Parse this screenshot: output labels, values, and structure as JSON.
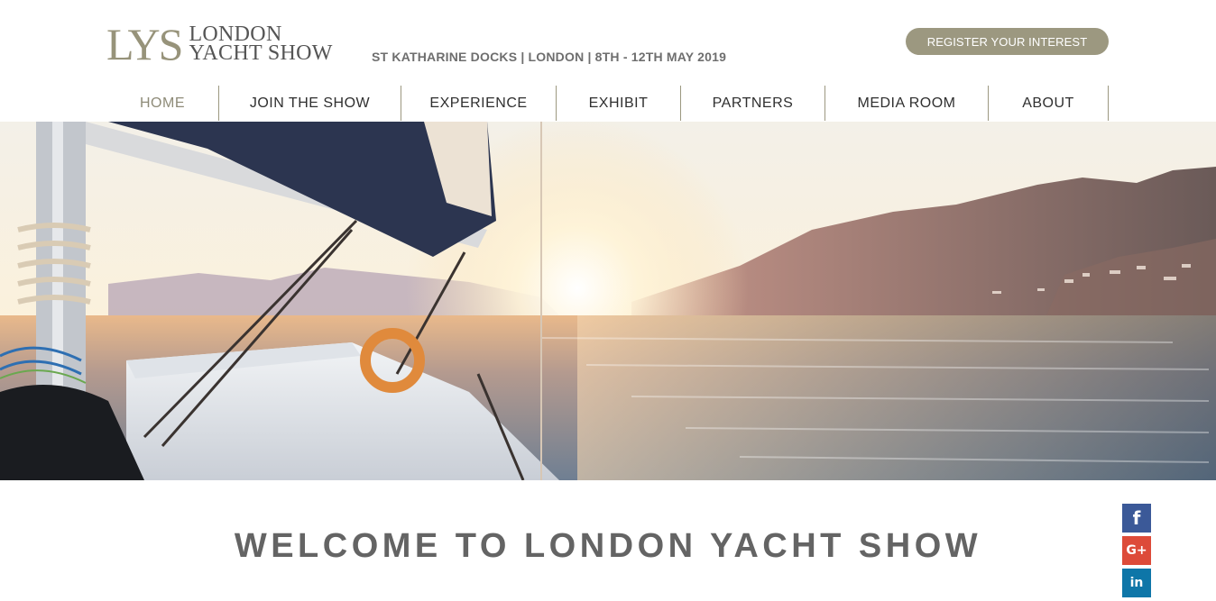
{
  "header": {
    "logo_mark": "LYS",
    "logo_line1": "LONDON",
    "logo_line2": "YACHT SHOW",
    "tagline": "ST KATHARINE DOCKS | LONDON | 8TH - 12TH MAY 2019",
    "register_label": "REGISTER YOUR INTEREST"
  },
  "nav": {
    "items": [
      {
        "label": "HOME",
        "active": true
      },
      {
        "label": "JOIN THE SHOW"
      },
      {
        "label": "EXPERIENCE"
      },
      {
        "label": "EXHIBIT"
      },
      {
        "label": "PARTNERS"
      },
      {
        "label": "MEDIA ROOM"
      },
      {
        "label": "ABOUT"
      }
    ]
  },
  "hero": {
    "image": "sailboat-sunset-image"
  },
  "main": {
    "heading": "WELCOME TO LONDON YACHT SHOW"
  },
  "social": {
    "facebook_glyph": "f",
    "googleplus_glyph": "G+",
    "linkedin_glyph": "in"
  },
  "colors": {
    "accent": "#9c9880",
    "text": "#2f2f2f",
    "facebook": "#3b5998",
    "googleplus": "#dd4b39",
    "linkedin": "#0e76a8"
  }
}
